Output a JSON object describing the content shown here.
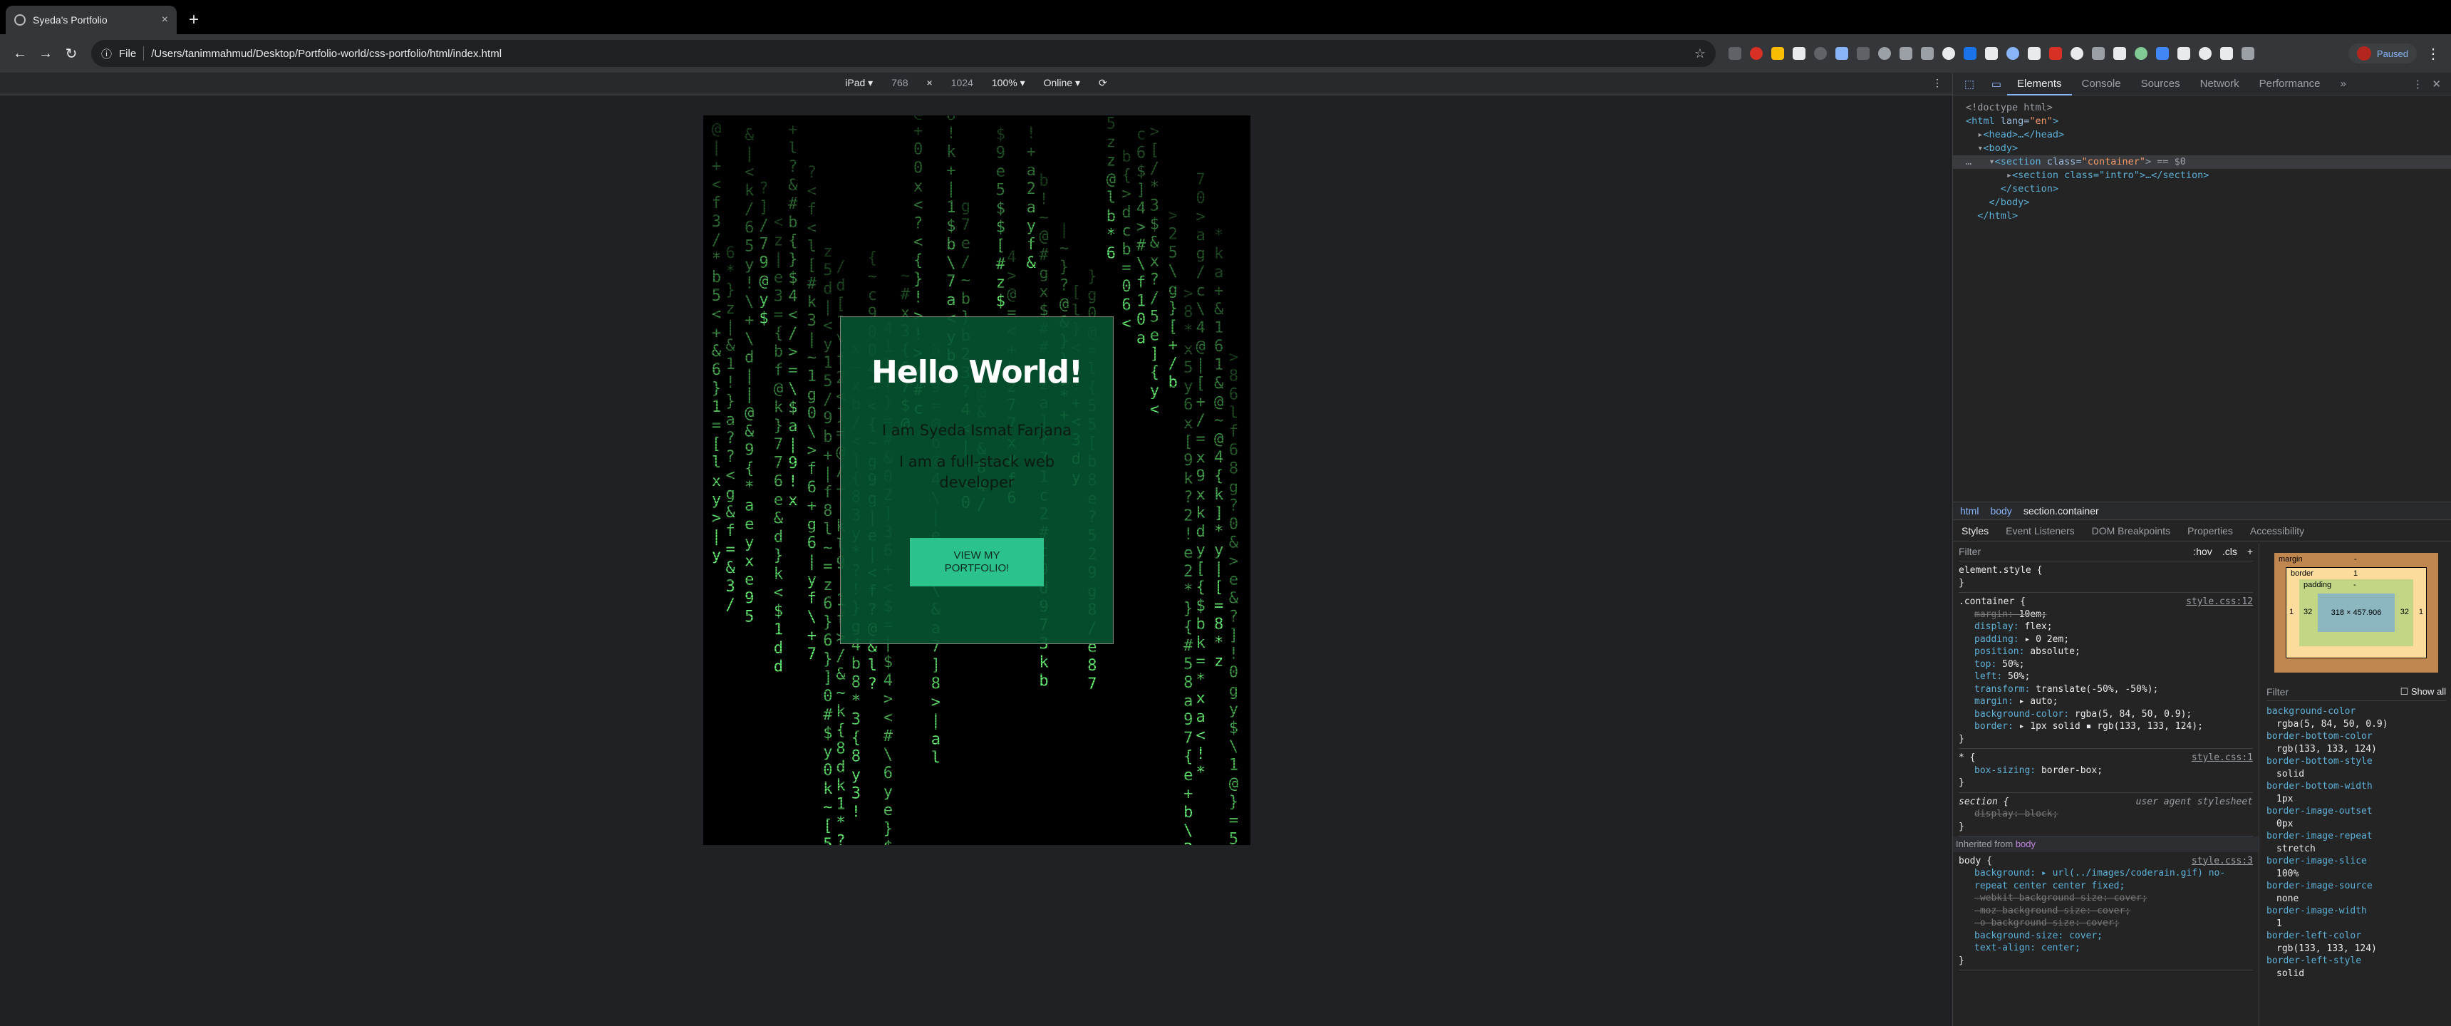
{
  "browser": {
    "tab_title": "Syeda's Portfolio",
    "tab_close": "×",
    "new_tab": "+",
    "scheme_label": "File",
    "url": "/Users/tanimmahmud/Desktop/Portfolio-world/css-portfolio/html/index.html",
    "profile_status": "Paused",
    "extension_colors": [
      "#5f6368",
      "#d93025",
      "#fbbc04",
      "#e8eaed",
      "#5f6368",
      "#8ab4f8",
      "#5f6368",
      "#9aa0a6",
      "#9aa0a6",
      "#9aa0a6",
      "#e8eaed",
      "#1a73e8",
      "#e8eaed",
      "#8ab4f8",
      "#e8eaed",
      "#d93025",
      "#e8eaed",
      "#9aa0a6",
      "#e8eaed",
      "#81c995",
      "#4285f4",
      "#e8eaed",
      "#e8eaed",
      "#e8eaed",
      "#9aa0a6"
    ]
  },
  "device_toolbar": {
    "device": "iPad ▾",
    "width": "768",
    "times": "×",
    "height": "1024",
    "zoom": "100% ▾",
    "network": "Online ▾",
    "more": "⋮"
  },
  "page": {
    "heading": "Hello World!",
    "intro": "I am Syeda Ismat Farjana",
    "role": "I am a full-stack web developer",
    "button": "VIEW MY PORTFOLIO!",
    "rain_color": "#6cff7a"
  },
  "devtools": {
    "tabs": [
      "Elements",
      "Console",
      "Sources",
      "Network",
      "Performance"
    ],
    "overflow": "»",
    "dom": {
      "doctype": "<!doctype html>",
      "html_open_tag": "<html",
      "html_attr": " lang=",
      "html_val": "\"en\"",
      "html_close": ">",
      "head": "<head>…</head>",
      "body_open": "<body>",
      "section_open": "<section",
      "section_attr": " class=",
      "section_val": "\"container\"",
      "section_end": "> == $0",
      "intro_line": "<section class=\"intro\">…</section>",
      "section_close": "</section>",
      "body_close": "</body>",
      "html_end": "</html>"
    },
    "breadcrumbs": [
      "html",
      "body",
      "section.container"
    ],
    "subtabs": [
      "Styles",
      "Event Listeners",
      "DOM Breakpoints",
      "Properties",
      "Accessibility"
    ],
    "filter_placeholder": "Filter",
    "hov": ":hov",
    "cls": ".cls",
    "plus": "+",
    "element_style": "element.style {",
    "container_rule": {
      "selector": ".container {",
      "source": "style.css:12",
      "props": [
        {
          "name": "margin",
          "value": "10em;",
          "struck": true
        },
        {
          "name": "display",
          "value": "flex;",
          "struck": false
        },
        {
          "name": "padding",
          "value": "▸ 0 2em;",
          "struck": false
        },
        {
          "name": "position",
          "value": "absolute;",
          "struck": false
        },
        {
          "name": "top",
          "value": "50%;",
          "struck": false
        },
        {
          "name": "left",
          "value": "50%;",
          "struck": false
        },
        {
          "name": "transform",
          "value": "translate(-50%, -50%);",
          "struck": false
        },
        {
          "name": "margin",
          "value": "▸ auto;",
          "struck": false
        },
        {
          "name": "background-color",
          "value": "rgba(5, 84, 50, 0.9);",
          "struck": false
        },
        {
          "name": "border",
          "value": "▸ 1px solid ▪ rgb(133, 133, 124);",
          "struck": false
        }
      ]
    },
    "universal_rule": {
      "selector": "* {",
      "source": "style.css:1",
      "prop": "box-sizing",
      "value": "border-box;"
    },
    "section_rule": {
      "selector": "section {",
      "source": "user agent stylesheet",
      "prop": "display",
      "value": "block;"
    },
    "inherited_label": "Inherited from",
    "inherited_from": "body",
    "body_rule": {
      "selector": "body {",
      "source": "style.css:3",
      "lines": [
        "background: ▸ url(../images/coderain.gif) no-",
        "    repeat center center fixed;",
        "-webkit-background-size: cover;",
        "-moz-background-size: cover;",
        "-o-background-size: cover;",
        "background-size: cover;",
        "text-align: center;"
      ]
    },
    "close_brace": "}",
    "box_model": {
      "margin_label": "margin",
      "margin_val": "-",
      "border_label": "border",
      "border_val": "1",
      "padding_label": "padding",
      "padding_val": "-",
      "content": "318 × 457.906",
      "side_left": "32",
      "side_right": "32",
      "border_left": "1",
      "border_right": "1"
    },
    "computed_filter": "Filter",
    "show_all": "Show all",
    "computed": [
      {
        "name": "background-color",
        "value": "rgba(5, 84, 50, 0.9)"
      },
      {
        "name": "border-bottom-color",
        "value": "rgb(133, 133, 124)"
      },
      {
        "name": "border-bottom-style",
        "value": "solid"
      },
      {
        "name": "border-bottom-width",
        "value": "1px"
      },
      {
        "name": "border-image-outset",
        "value": "0px"
      },
      {
        "name": "border-image-repeat",
        "value": "stretch"
      },
      {
        "name": "border-image-slice",
        "value": "100%"
      },
      {
        "name": "border-image-source",
        "value": "none"
      },
      {
        "name": "border-image-width",
        "value": "1"
      },
      {
        "name": "border-left-color",
        "value": "rgb(133, 133, 124)"
      },
      {
        "name": "border-left-style",
        "value": "solid"
      }
    ]
  }
}
